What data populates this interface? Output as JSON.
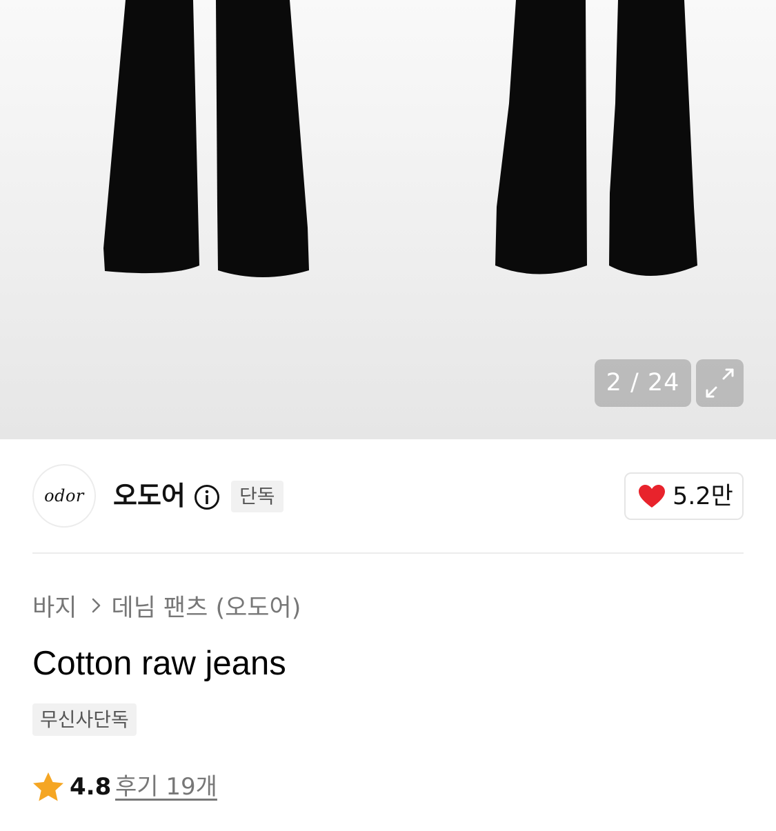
{
  "gallery": {
    "counter_current": "2",
    "counter_total": "24",
    "counter_text": "2 / 24"
  },
  "brand": {
    "logo_text": "odor",
    "name": "오도어",
    "exclusive_badge": "단독"
  },
  "likes": {
    "count": "5.2만"
  },
  "breadcrumb": {
    "items": [
      "바지",
      "데님 팬츠 (오도어)"
    ]
  },
  "product": {
    "title": "Cotton raw jeans",
    "tag": "무신사단독"
  },
  "rating": {
    "score": "4.8",
    "review_link": "후기 19개"
  },
  "colors": {
    "accent_star": "#f5a623",
    "heart": "#e8232c",
    "pants": "#0a0a0a"
  },
  "icons": {
    "info": "info-circle-icon",
    "expand": "expand-arrows-icon",
    "heart": "heart-icon",
    "chevron": "chevron-right-icon",
    "star": "star-icon"
  }
}
